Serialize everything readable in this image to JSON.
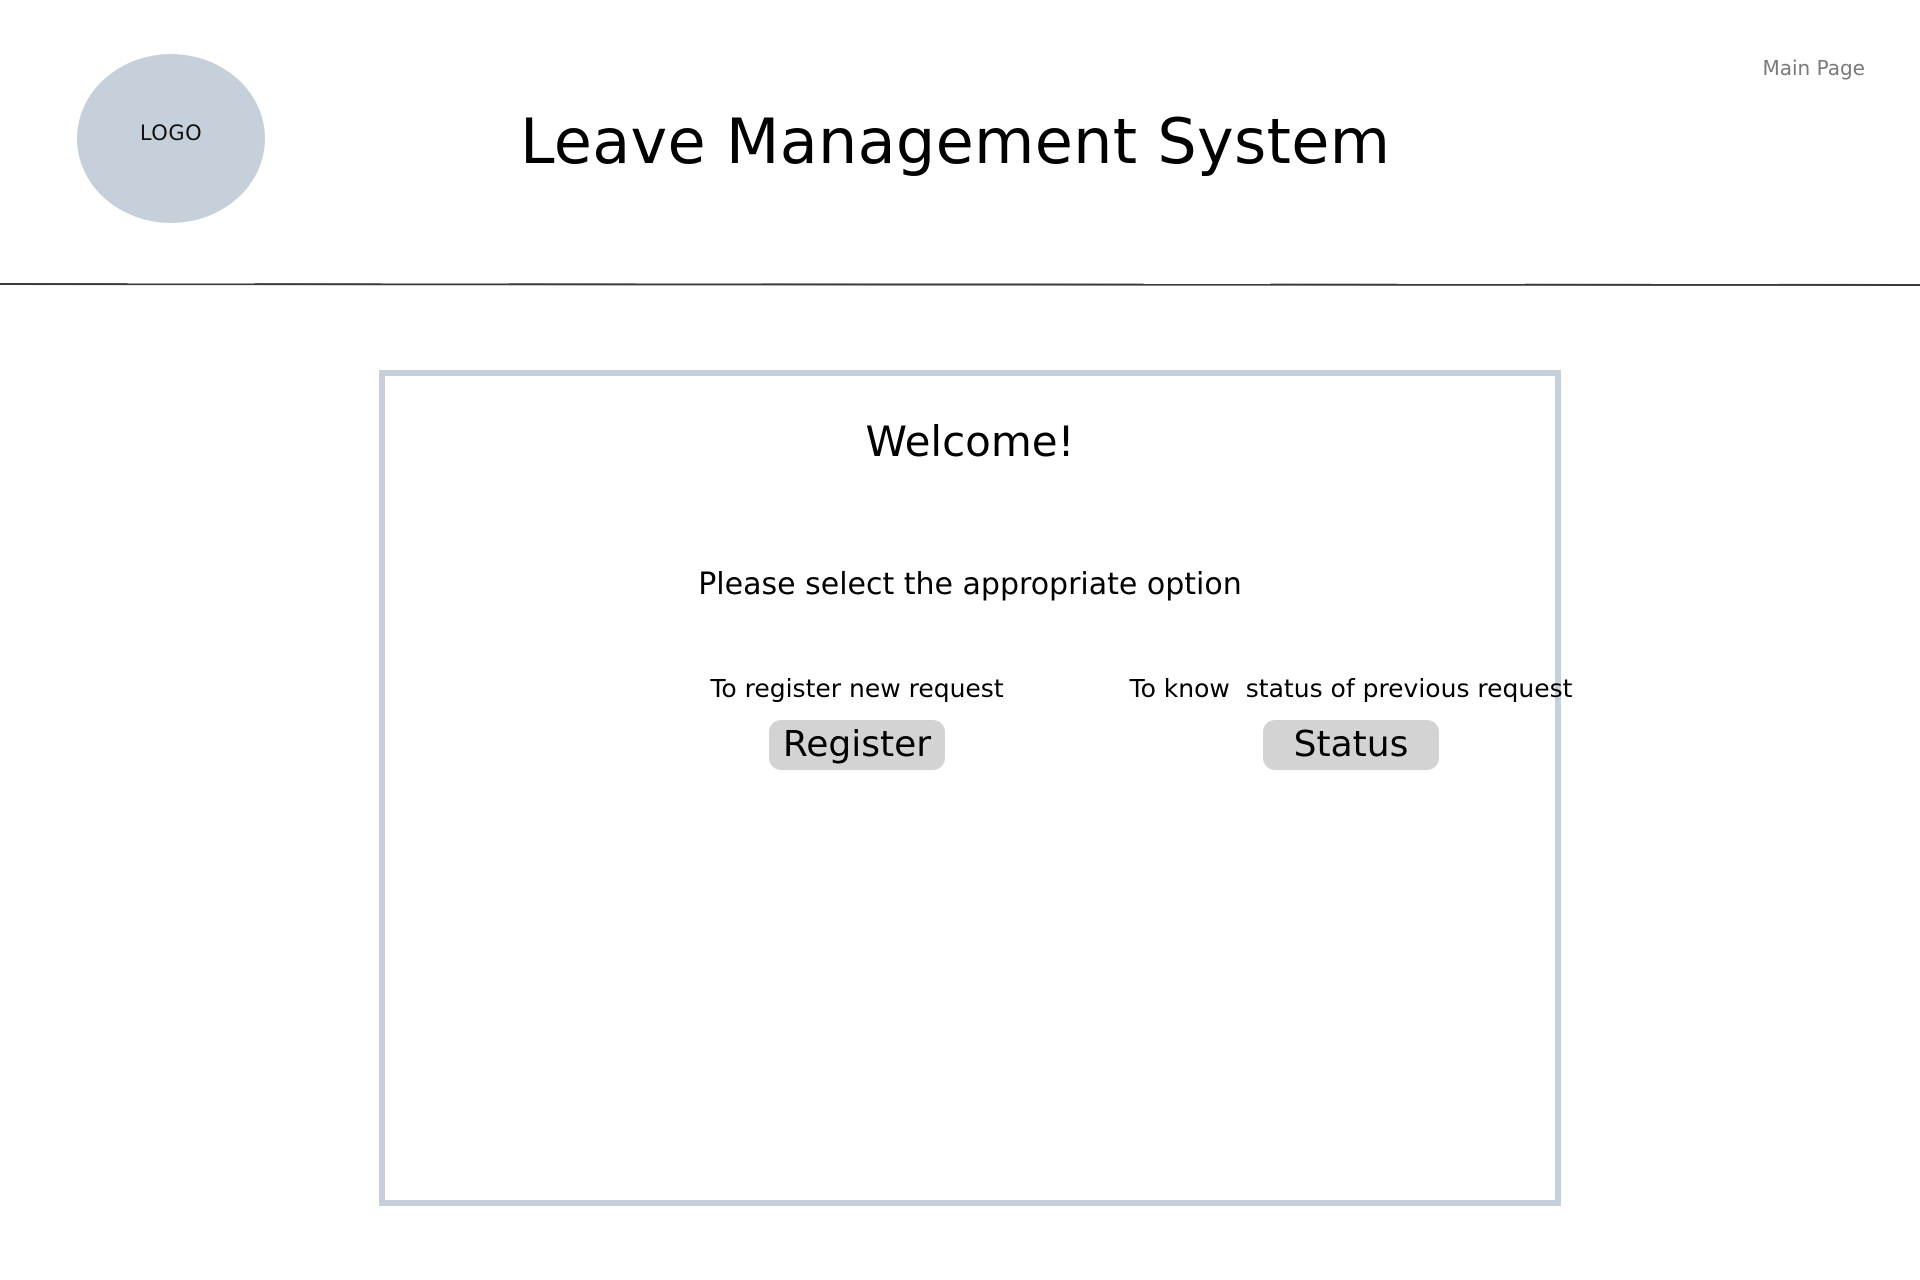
{
  "header": {
    "logo_text": "LOGO",
    "title": "Leave Management System",
    "nav_link": "Main Page"
  },
  "panel": {
    "welcome": "Welcome!",
    "instruction": "Please select the appropriate option",
    "options": [
      {
        "caption": "To register new request",
        "button_label": "Register"
      },
      {
        "caption": "To know  status of previous request",
        "button_label": "Status"
      }
    ]
  },
  "colors": {
    "logo_fill": "#c5d0da",
    "panel_border": "#c5d0da",
    "button_fill": "#d3d3d3",
    "nav_link_text": "#7a7a7a"
  }
}
